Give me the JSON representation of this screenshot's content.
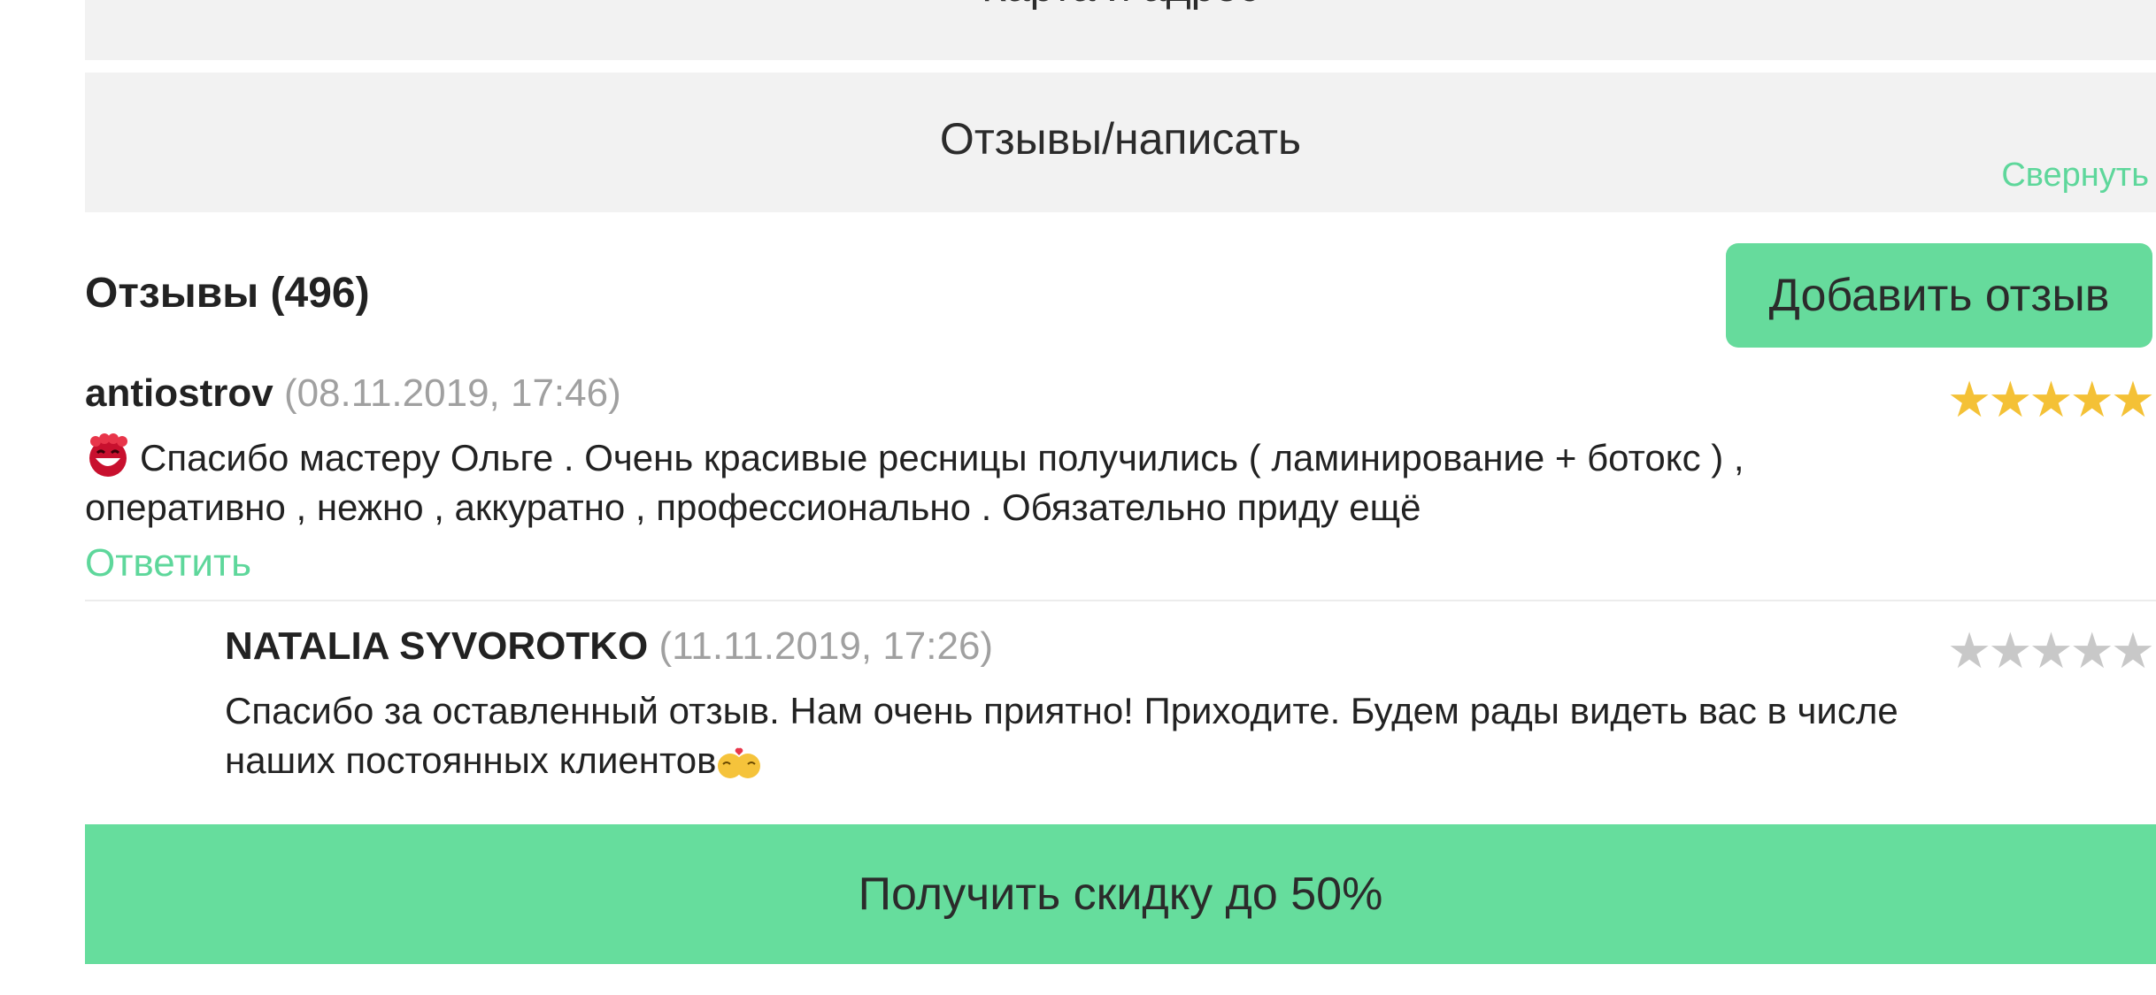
{
  "sections": {
    "map_label": "Карта и адрес",
    "reviews_label": "Отзывы/написать",
    "collapse_label": "Свернуть"
  },
  "reviews_header": {
    "title": "Отзывы (496)",
    "add_button": "Добавить отзыв"
  },
  "reviews": [
    {
      "author": "antiostrov",
      "date": "(08.11.2019, 17:46)",
      "rating": 5,
      "text_line1": "Спасибо мастеру Ольге . Очень красивые ресницы получились ( ламинирование + ботокс ) ,",
      "text_line2": "оперативно , нежно , аккуратно , профессионально . Обязательно приду ещё",
      "reply_label": "Ответить",
      "emoji": "smiling-face-with-hearts-icon"
    }
  ],
  "reply": {
    "author": "NATALIA SYVOROTKO",
    "date": "(11.11.2019, 17:26)",
    "rating": 0,
    "text_line1": "Спасибо за оставленный отзыв. Нам очень приятно! Приходите. Будем рады видеть вас в числе",
    "text_line2": "наших постоянных клиентов",
    "emoji": "kissing-couple-icon"
  },
  "discount_button": "Получить скидку до 50%",
  "colors": {
    "accent": "#66db9c",
    "link": "#5ed79b",
    "star_filled": "#f4c136",
    "star_empty": "#c8c8c8",
    "panel_bg": "#f2f2f2"
  }
}
